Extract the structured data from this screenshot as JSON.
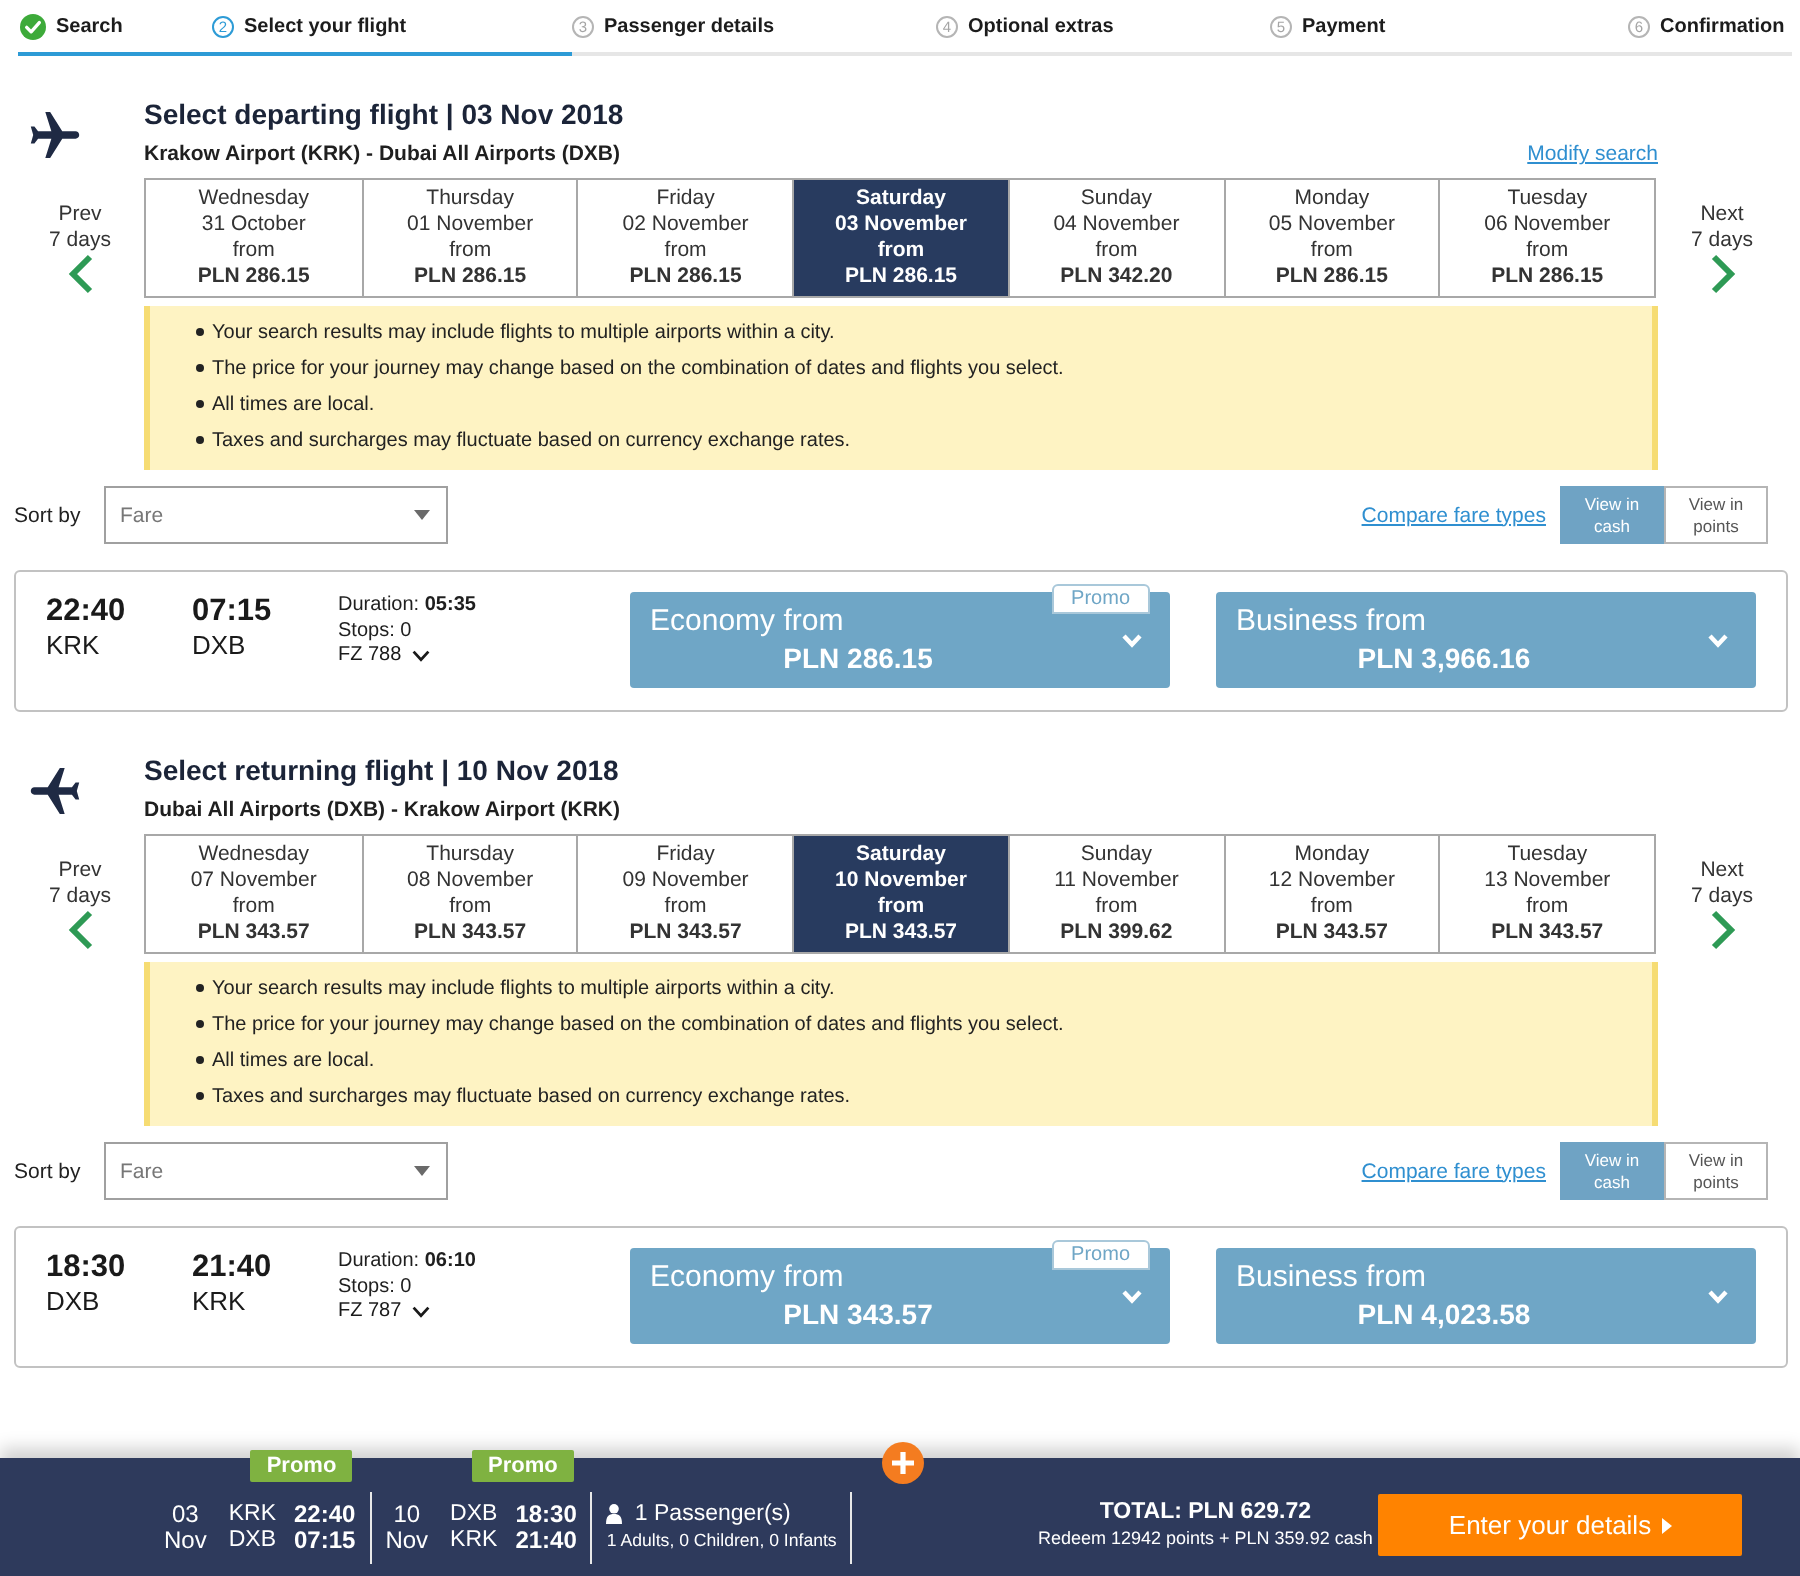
{
  "steps": [
    {
      "label": "Search",
      "completed": true,
      "selected": false
    },
    {
      "number": "2",
      "label": "Select your flight",
      "completed": false,
      "selected": true
    },
    {
      "number": "3",
      "label": "Passenger details",
      "completed": false,
      "selected": false
    },
    {
      "number": "4",
      "label": "Optional extras",
      "completed": false,
      "selected": false
    },
    {
      "number": "5",
      "label": "Payment",
      "completed": false,
      "selected": false
    },
    {
      "number": "6",
      "label": "Confirmation",
      "completed": false,
      "selected": false
    }
  ],
  "journeys": [
    {
      "kind": "outbound",
      "title": "Select departing flight | 03 Nov 2018",
      "route": "Krakow Airport (KRK) - Dubai All Airports (DXB)",
      "modify_link": "Modify search",
      "prev": {
        "label": "Prev",
        "sub": "7 days"
      },
      "next": {
        "label": "Next",
        "sub": "7 days"
      },
      "dates": [
        {
          "day": "Wednesday",
          "date": "31 October",
          "from_label": "from",
          "price": "PLN 286.15",
          "selected": false
        },
        {
          "day": "Thursday",
          "date": "01 November",
          "from_label": "from",
          "price": "PLN 286.15",
          "selected": false
        },
        {
          "day": "Friday",
          "date": "02 November",
          "from_label": "from",
          "price": "PLN 286.15",
          "selected": false
        },
        {
          "day": "Saturday",
          "date": "03 November",
          "from_label": "from",
          "price": "PLN 286.15",
          "selected": true
        },
        {
          "day": "Sunday",
          "date": "04 November",
          "from_label": "from",
          "price": "PLN 342.20",
          "selected": false
        },
        {
          "day": "Monday",
          "date": "05 November",
          "from_label": "from",
          "price": "PLN 286.15",
          "selected": false
        },
        {
          "day": "Tuesday",
          "date": "06 November",
          "from_label": "from",
          "price": "PLN 286.15",
          "selected": false
        }
      ],
      "notices": [
        "Your search results may include flights to multiple airports within a city.",
        "The price for your journey may change based on the combination of dates and flights you select.",
        "All times are local.",
        "Taxes and surcharges may fluctuate based on currency exchange rates."
      ],
      "sort": {
        "label": "Sort by",
        "value": "Fare"
      },
      "compare_link": "Compare fare types",
      "view_modes": [
        {
          "label": "View in cash",
          "selected": true
        },
        {
          "label": "View in points",
          "selected": false
        }
      ],
      "flight": {
        "depart_time": "22:40",
        "depart_code": "KRK",
        "arrive_time": "07:15",
        "arrive_code": "DXB",
        "duration": "Duration: **05:35**",
        "stops": "Stops: 0",
        "flight_number": "FZ 788",
        "fares": [
          {
            "label": "Economy from",
            "price": "PLN 286.15",
            "promo": "Promo"
          },
          {
            "label": "Business from",
            "price": "PLN 3,966.16"
          }
        ]
      }
    },
    {
      "kind": "return",
      "title": "Select returning flight | 10 Nov 2018",
      "route": "Dubai All Airports (DXB) - Krakow Airport (KRK)",
      "prev": {
        "label": "Prev",
        "sub": "7 days"
      },
      "next": {
        "label": "Next",
        "sub": "7 days"
      },
      "dates": [
        {
          "day": "Wednesday",
          "date": "07 November",
          "from_label": "from",
          "price": "PLN 343.57",
          "selected": false
        },
        {
          "day": "Thursday",
          "date": "08 November",
          "from_label": "from",
          "price": "PLN 343.57",
          "selected": false
        },
        {
          "day": "Friday",
          "date": "09 November",
          "from_label": "from",
          "price": "PLN 343.57",
          "selected": false
        },
        {
          "day": "Saturday",
          "date": "10 November",
          "from_label": "from",
          "price": "PLN 343.57",
          "selected": true
        },
        {
          "day": "Sunday",
          "date": "11 November",
          "from_label": "from",
          "price": "PLN 399.62",
          "selected": false
        },
        {
          "day": "Monday",
          "date": "12 November",
          "from_label": "from",
          "price": "PLN 343.57",
          "selected": false
        },
        {
          "day": "Tuesday",
          "date": "13 November",
          "from_label": "from",
          "price": "PLN 343.57",
          "selected": false
        }
      ],
      "notices": [
        "Your search results may include flights to multiple airports within a city.",
        "The price for your journey may change based on the combination of dates and flights you select.",
        "All times are local.",
        "Taxes and surcharges may fluctuate based on currency exchange rates."
      ],
      "sort": {
        "label": "Sort by",
        "value": "Fare"
      },
      "compare_link": "Compare fare types",
      "view_modes": [
        {
          "label": "View in cash",
          "selected": true
        },
        {
          "label": "View in points",
          "selected": false
        }
      ],
      "flight": {
        "depart_time": "18:30",
        "depart_code": "DXB",
        "arrive_time": "21:40",
        "arrive_code": "KRK",
        "duration": "Duration: **06:10**",
        "stops": "Stops: 0",
        "flight_number": "FZ 787",
        "fares": [
          {
            "label": "Economy from",
            "price": "PLN 343.57",
            "promo": "Promo"
          },
          {
            "label": "Business from",
            "price": "PLN 4,023.58"
          }
        ]
      }
    }
  ],
  "summary": {
    "legs": [
      {
        "promo": "Promo",
        "day": "03",
        "month": "Nov",
        "from_code": "KRK",
        "to_code": "DXB",
        "depart_time": "22:40",
        "arrive_time": "07:15"
      },
      {
        "promo": "Promo",
        "day": "10",
        "month": "Nov",
        "from_code": "DXB",
        "to_code": "KRK",
        "depart_time": "18:30",
        "arrive_time": "21:40"
      }
    ],
    "passengers": {
      "title": "1 Passenger(s)",
      "detail": "1 Adults, 0 Children, 0 Infants"
    },
    "total": "TOTAL: PLN 629.72",
    "redeem": "Redeem 12942 points + PLN 359.92 cash",
    "cta": "Enter your details"
  }
}
